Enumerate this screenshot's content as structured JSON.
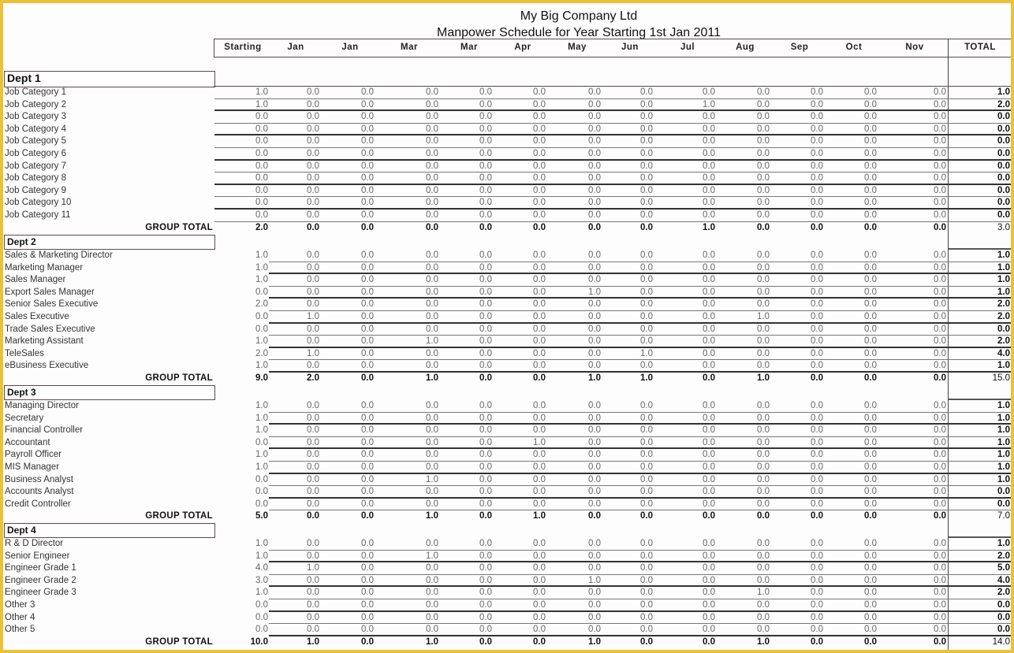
{
  "title": {
    "company": "My Big Company Ltd",
    "subtitle": "Manpower Schedule for Year Starting 1st Jan 2011"
  },
  "columns": [
    "Starting",
    "Jan",
    "Jan",
    "Mar",
    "Mar",
    "Apr",
    "May",
    "Jun",
    "Jul",
    "Aug",
    "Sep",
    "Oct",
    "Nov",
    "TOTAL"
  ],
  "group_total_label": "GROUP TOTAL",
  "departments": [
    {
      "name": "Dept 1",
      "rows": [
        {
          "label": "Job Category 1",
          "values": [
            "1.0",
            "0.0",
            "0.0",
            "0.0",
            "0.0",
            "0.0",
            "0.0",
            "0.0",
            "0.0",
            "0.0",
            "0.0",
            "0.0",
            "0.0"
          ],
          "total": "1.0"
        },
        {
          "label": "Job Category 2",
          "values": [
            "1.0",
            "0.0",
            "0.0",
            "0.0",
            "0.0",
            "0.0",
            "0.0",
            "0.0",
            "1.0",
            "0.0",
            "0.0",
            "0.0",
            "0.0"
          ],
          "total": "2.0"
        },
        {
          "label": "Job Category 3",
          "values": [
            "0.0",
            "0.0",
            "0.0",
            "0.0",
            "0.0",
            "0.0",
            "0.0",
            "0.0",
            "0.0",
            "0.0",
            "0.0",
            "0.0",
            "0.0"
          ],
          "total": "0.0"
        },
        {
          "label": "Job Category 4",
          "values": [
            "0.0",
            "0.0",
            "0.0",
            "0.0",
            "0.0",
            "0.0",
            "0.0",
            "0.0",
            "0.0",
            "0.0",
            "0.0",
            "0.0",
            "0.0"
          ],
          "total": "0.0"
        },
        {
          "label": "Job Category 5",
          "values": [
            "0.0",
            "0.0",
            "0.0",
            "0.0",
            "0.0",
            "0.0",
            "0.0",
            "0.0",
            "0.0",
            "0.0",
            "0.0",
            "0.0",
            "0.0"
          ],
          "total": "0.0"
        },
        {
          "label": "Job Category 6",
          "values": [
            "0.0",
            "0.0",
            "0.0",
            "0.0",
            "0.0",
            "0.0",
            "0.0",
            "0.0",
            "0.0",
            "0.0",
            "0.0",
            "0.0",
            "0.0"
          ],
          "total": "0.0"
        },
        {
          "label": "Job Category 7",
          "values": [
            "0.0",
            "0.0",
            "0.0",
            "0.0",
            "0.0",
            "0.0",
            "0.0",
            "0.0",
            "0.0",
            "0.0",
            "0.0",
            "0.0",
            "0.0"
          ],
          "total": "0.0"
        },
        {
          "label": "Job Category 8",
          "values": [
            "0.0",
            "0.0",
            "0.0",
            "0.0",
            "0.0",
            "0.0",
            "0.0",
            "0.0",
            "0.0",
            "0.0",
            "0.0",
            "0.0",
            "0.0"
          ],
          "total": "0.0"
        },
        {
          "label": "Job Category 9",
          "values": [
            "0.0",
            "0.0",
            "0.0",
            "0.0",
            "0.0",
            "0.0",
            "0.0",
            "0.0",
            "0.0",
            "0.0",
            "0.0",
            "0.0",
            "0.0"
          ],
          "total": "0.0"
        },
        {
          "label": "Job Category 10",
          "values": [
            "0.0",
            "0.0",
            "0.0",
            "0.0",
            "0.0",
            "0.0",
            "0.0",
            "0.0",
            "0.0",
            "0.0",
            "0.0",
            "0.0",
            "0.0"
          ],
          "total": "0.0"
        },
        {
          "label": "Job Category 11",
          "values": [
            "0.0",
            "0.0",
            "0.0",
            "0.0",
            "0.0",
            "0.0",
            "0.0",
            "0.0",
            "0.0",
            "0.0",
            "0.0",
            "0.0",
            "0.0"
          ],
          "total": "0.0"
        }
      ],
      "group_total": {
        "values": [
          "2.0",
          "0.0",
          "0.0",
          "0.0",
          "0.0",
          "0.0",
          "0.0",
          "0.0",
          "1.0",
          "0.0",
          "0.0",
          "0.0",
          "0.0"
        ],
        "total": "3.0"
      }
    },
    {
      "name": "Dept 2",
      "rows": [
        {
          "label": "Sales & Marketing Director",
          "values": [
            "1.0",
            "0.0",
            "0.0",
            "0.0",
            "0.0",
            "0.0",
            "0.0",
            "0.0",
            "0.0",
            "0.0",
            "0.0",
            "0.0",
            "0.0"
          ],
          "total": "1.0"
        },
        {
          "label": "Marketing Manager",
          "values": [
            "1.0",
            "0.0",
            "0.0",
            "0.0",
            "0.0",
            "0.0",
            "0.0",
            "0.0",
            "0.0",
            "0.0",
            "0.0",
            "0.0",
            "0.0"
          ],
          "total": "1.0"
        },
        {
          "label": "Sales Manager",
          "values": [
            "1.0",
            "0.0",
            "0.0",
            "0.0",
            "0.0",
            "0.0",
            "0.0",
            "0.0",
            "0.0",
            "0.0",
            "0.0",
            "0.0",
            "0.0"
          ],
          "total": "1.0"
        },
        {
          "label": "Export Sales Manager",
          "values": [
            "0.0",
            "0.0",
            "0.0",
            "0.0",
            "0.0",
            "0.0",
            "1.0",
            "0.0",
            "0.0",
            "0.0",
            "0.0",
            "0.0",
            "0.0"
          ],
          "total": "1.0"
        },
        {
          "label": "Senior Sales Executive",
          "values": [
            "2.0",
            "0.0",
            "0.0",
            "0.0",
            "0.0",
            "0.0",
            "0.0",
            "0.0",
            "0.0",
            "0.0",
            "0.0",
            "0.0",
            "0.0"
          ],
          "total": "2.0"
        },
        {
          "label": "Sales Executive",
          "values": [
            "0.0",
            "1.0",
            "0.0",
            "0.0",
            "0.0",
            "0.0",
            "0.0",
            "0.0",
            "0.0",
            "1.0",
            "0.0",
            "0.0",
            "0.0"
          ],
          "total": "2.0"
        },
        {
          "label": "Trade Sales Executive",
          "values": [
            "0.0",
            "0.0",
            "0.0",
            "0.0",
            "0.0",
            "0.0",
            "0.0",
            "0.0",
            "0.0",
            "0.0",
            "0.0",
            "0.0",
            "0.0"
          ],
          "total": "0.0"
        },
        {
          "label": "Marketing Assistant",
          "values": [
            "1.0",
            "0.0",
            "0.0",
            "1.0",
            "0.0",
            "0.0",
            "0.0",
            "0.0",
            "0.0",
            "0.0",
            "0.0",
            "0.0",
            "0.0"
          ],
          "total": "2.0"
        },
        {
          "label": "TeleSales",
          "values": [
            "2.0",
            "1.0",
            "0.0",
            "0.0",
            "0.0",
            "0.0",
            "0.0",
            "1.0",
            "0.0",
            "0.0",
            "0.0",
            "0.0",
            "0.0"
          ],
          "total": "4.0"
        },
        {
          "label": "eBusiness Executive",
          "values": [
            "1.0",
            "0.0",
            "0.0",
            "0.0",
            "0.0",
            "0.0",
            "0.0",
            "0.0",
            "0.0",
            "0.0",
            "0.0",
            "0.0",
            "0.0"
          ],
          "total": "1.0"
        }
      ],
      "group_total": {
        "values": [
          "9.0",
          "2.0",
          "0.0",
          "1.0",
          "0.0",
          "0.0",
          "1.0",
          "1.0",
          "0.0",
          "1.0",
          "0.0",
          "0.0",
          "0.0"
        ],
        "total": "15.0"
      }
    },
    {
      "name": "Dept 3",
      "rows": [
        {
          "label": "Managing Director",
          "values": [
            "1.0",
            "0.0",
            "0.0",
            "0.0",
            "0.0",
            "0.0",
            "0.0",
            "0.0",
            "0.0",
            "0.0",
            "0.0",
            "0.0",
            "0.0"
          ],
          "total": "1.0"
        },
        {
          "label": "Secretary",
          "values": [
            "1.0",
            "0.0",
            "0.0",
            "0.0",
            "0.0",
            "0.0",
            "0.0",
            "0.0",
            "0.0",
            "0.0",
            "0.0",
            "0.0",
            "0.0"
          ],
          "total": "1.0"
        },
        {
          "label": "Financial Controller",
          "values": [
            "1.0",
            "0.0",
            "0.0",
            "0.0",
            "0.0",
            "0.0",
            "0.0",
            "0.0",
            "0.0",
            "0.0",
            "0.0",
            "0.0",
            "0.0"
          ],
          "total": "1.0"
        },
        {
          "label": "Accountant",
          "values": [
            "0.0",
            "0.0",
            "0.0",
            "0.0",
            "0.0",
            "1.0",
            "0.0",
            "0.0",
            "0.0",
            "0.0",
            "0.0",
            "0.0",
            "0.0"
          ],
          "total": "1.0"
        },
        {
          "label": "Payroll Officer",
          "values": [
            "1.0",
            "0.0",
            "0.0",
            "0.0",
            "0.0",
            "0.0",
            "0.0",
            "0.0",
            "0.0",
            "0.0",
            "0.0",
            "0.0",
            "0.0"
          ],
          "total": "1.0"
        },
        {
          "label": "MIS Manager",
          "values": [
            "1.0",
            "0.0",
            "0.0",
            "0.0",
            "0.0",
            "0.0",
            "0.0",
            "0.0",
            "0.0",
            "0.0",
            "0.0",
            "0.0",
            "0.0"
          ],
          "total": "1.0"
        },
        {
          "label": "Business Analyst",
          "values": [
            "0.0",
            "0.0",
            "0.0",
            "1.0",
            "0.0",
            "0.0",
            "0.0",
            "0.0",
            "0.0",
            "0.0",
            "0.0",
            "0.0",
            "0.0"
          ],
          "total": "1.0"
        },
        {
          "label": "Accounts Analyst",
          "values": [
            "0.0",
            "0.0",
            "0.0",
            "0.0",
            "0.0",
            "0.0",
            "0.0",
            "0.0",
            "0.0",
            "0.0",
            "0.0",
            "0.0",
            "0.0"
          ],
          "total": "0.0"
        },
        {
          "label": "Credit Controller",
          "values": [
            "0.0",
            "0.0",
            "0.0",
            "0.0",
            "0.0",
            "0.0",
            "0.0",
            "0.0",
            "0.0",
            "0.0",
            "0.0",
            "0.0",
            "0.0"
          ],
          "total": "0.0"
        }
      ],
      "group_total": {
        "values": [
          "5.0",
          "0.0",
          "0.0",
          "1.0",
          "0.0",
          "1.0",
          "0.0",
          "0.0",
          "0.0",
          "0.0",
          "0.0",
          "0.0",
          "0.0"
        ],
        "total": "7.0"
      }
    },
    {
      "name": "Dept 4",
      "rows": [
        {
          "label": "R & D Director",
          "values": [
            "1.0",
            "0.0",
            "0.0",
            "0.0",
            "0.0",
            "0.0",
            "0.0",
            "0.0",
            "0.0",
            "0.0",
            "0.0",
            "0.0",
            "0.0"
          ],
          "total": "1.0"
        },
        {
          "label": "Senior Engineer",
          "values": [
            "1.0",
            "0.0",
            "0.0",
            "1.0",
            "0.0",
            "0.0",
            "0.0",
            "0.0",
            "0.0",
            "0.0",
            "0.0",
            "0.0",
            "0.0"
          ],
          "total": "2.0"
        },
        {
          "label": "Engineer Grade 1",
          "values": [
            "4.0",
            "1.0",
            "0.0",
            "0.0",
            "0.0",
            "0.0",
            "0.0",
            "0.0",
            "0.0",
            "0.0",
            "0.0",
            "0.0",
            "0.0"
          ],
          "total": "5.0"
        },
        {
          "label": "Engineer Grade 2",
          "values": [
            "3.0",
            "0.0",
            "0.0",
            "0.0",
            "0.0",
            "0.0",
            "1.0",
            "0.0",
            "0.0",
            "0.0",
            "0.0",
            "0.0",
            "0.0"
          ],
          "total": "4.0"
        },
        {
          "label": "Engineer Grade 3",
          "values": [
            "1.0",
            "0.0",
            "0.0",
            "0.0",
            "0.0",
            "0.0",
            "0.0",
            "0.0",
            "0.0",
            "1.0",
            "0.0",
            "0.0",
            "0.0"
          ],
          "total": "2.0"
        },
        {
          "label": "Other 3",
          "values": [
            "0.0",
            "0.0",
            "0.0",
            "0.0",
            "0.0",
            "0.0",
            "0.0",
            "0.0",
            "0.0",
            "0.0",
            "0.0",
            "0.0",
            "0.0"
          ],
          "total": "0.0"
        },
        {
          "label": "Other 4",
          "values": [
            "0.0",
            "0.0",
            "0.0",
            "0.0",
            "0.0",
            "0.0",
            "0.0",
            "0.0",
            "0.0",
            "0.0",
            "0.0",
            "0.0",
            "0.0"
          ],
          "total": "0.0"
        },
        {
          "label": "Other 5",
          "values": [
            "0.0",
            "0.0",
            "0.0",
            "0.0",
            "0.0",
            "0.0",
            "0.0",
            "0.0",
            "0.0",
            "0.0",
            "0.0",
            "0.0",
            "0.0"
          ],
          "total": "0.0"
        }
      ],
      "group_total": {
        "values": [
          "10.0",
          "1.0",
          "0.0",
          "1.0",
          "0.0",
          "0.0",
          "1.0",
          "0.0",
          "0.0",
          "1.0",
          "0.0",
          "0.0",
          "0.0"
        ],
        "total": "14.0"
      }
    }
  ]
}
